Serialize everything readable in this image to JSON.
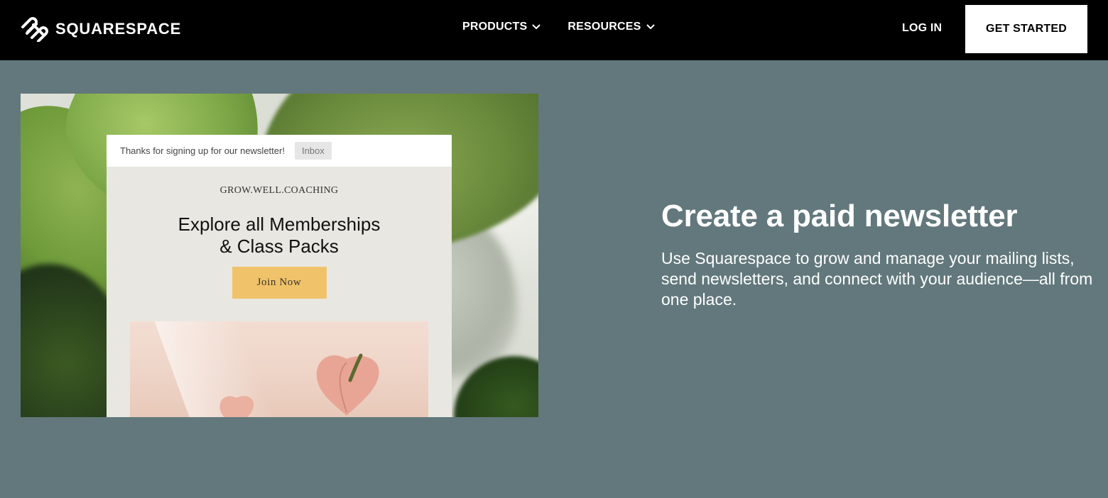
{
  "header": {
    "brand": "SQUARESPACE",
    "nav": [
      {
        "label": "PRODUCTS"
      },
      {
        "label": "RESOURCES"
      }
    ],
    "login_label": "LOG IN",
    "cta_label": "GET STARTED"
  },
  "hero": {
    "email": {
      "subject": "Thanks for signing up for our newsletter!",
      "tag": "Inbox",
      "brand_name": "GROW.WELL.COACHING",
      "headline_line1": "Explore all Memberships",
      "headline_line2": "& Class Packs",
      "button_label": "Join Now"
    },
    "title": "Create a paid newsletter",
    "description": "Use Squarespace to grow and manage your mailing lists, send newsletters, and connect with your audience—all from one place."
  },
  "colors": {
    "page_background": "#62787c",
    "header_background": "#000000",
    "join_button": "#f0c36b"
  },
  "icons": [
    "squarespace-logo-icon",
    "chevron-down-icon"
  ]
}
